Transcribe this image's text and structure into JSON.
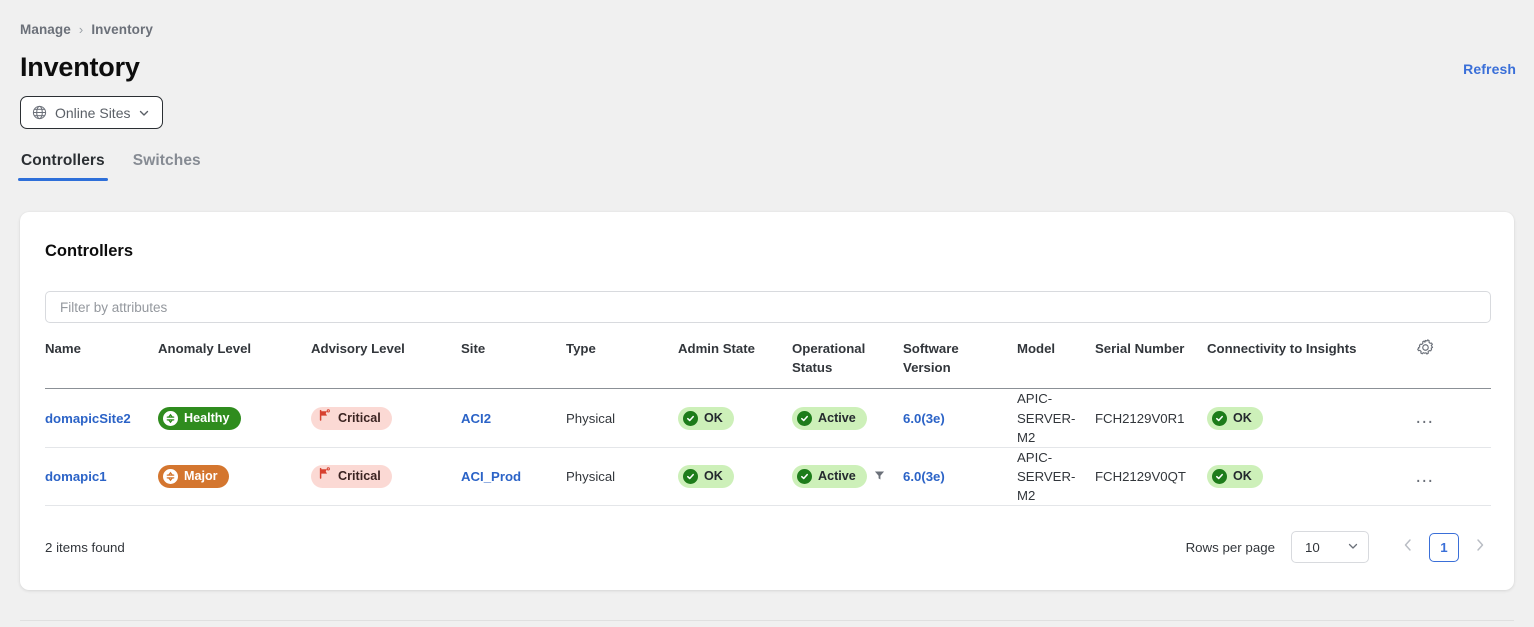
{
  "breadcrumb": {
    "parent": "Manage",
    "separator": "›",
    "current": "Inventory"
  },
  "header": {
    "title": "Inventory",
    "refresh_label": "Refresh",
    "site_selector": {
      "label": "Online Sites",
      "icon": "globe-icon",
      "chevron": "chevron-down-icon"
    }
  },
  "tabs": [
    {
      "label": "Controllers",
      "active": true
    },
    {
      "label": "Switches",
      "active": false
    }
  ],
  "card": {
    "title": "Controllers",
    "filter": {
      "placeholder": "Filter by attributes",
      "value": ""
    },
    "settings_icon": "gear-icon"
  },
  "table": {
    "columns": [
      {
        "label": "Name"
      },
      {
        "label": "Anomaly Level"
      },
      {
        "label": "Advisory Level"
      },
      {
        "label": "Site"
      },
      {
        "label": "Type"
      },
      {
        "label": "Admin State"
      },
      {
        "label": "Operational Status"
      },
      {
        "label": "Software Version"
      },
      {
        "label": "Model"
      },
      {
        "label": "Serial Number"
      },
      {
        "label": "Connectivity to Insights"
      }
    ],
    "rows": [
      {
        "name": "domapicSite2",
        "anomaly_level": "Healthy",
        "advisory_level": "Critical",
        "site": "ACI2",
        "type": "Physical",
        "admin_state": "OK",
        "operational_status": "Active",
        "operational_filtered": false,
        "software_version": "6.0(3e)",
        "model": "APIC-SERVER-M2",
        "serial_number": "FCH2129V0R1",
        "connectivity": "OK",
        "row_menu": "…"
      },
      {
        "name": "domapic1",
        "anomaly_level": "Major",
        "advisory_level": "Critical",
        "site": "ACI_Prod",
        "type": "Physical",
        "admin_state": "OK",
        "operational_status": "Active",
        "operational_filtered": true,
        "software_version": "6.0(3e)",
        "model": "APIC-SERVER-M2",
        "serial_number": "FCH2129V0QT",
        "connectivity": "OK",
        "row_menu": "…"
      }
    ]
  },
  "footer": {
    "items_found": "2 items found",
    "rows_per_page_label": "Rows per page",
    "rows_per_page_value": "10",
    "page_current": "1",
    "prev_icon": "chevron-left-icon",
    "next_icon": "chevron-right-icon"
  },
  "colors": {
    "page_bg": "#f0f0f0",
    "accent_blue": "#3a6fd8",
    "link_blue": "#2b63c7",
    "healthy_green": "#2f8c1e",
    "major_orange": "#d4762f",
    "critical_pink": "#fbd9d4",
    "ok_light_green": "#cdf0b9"
  }
}
